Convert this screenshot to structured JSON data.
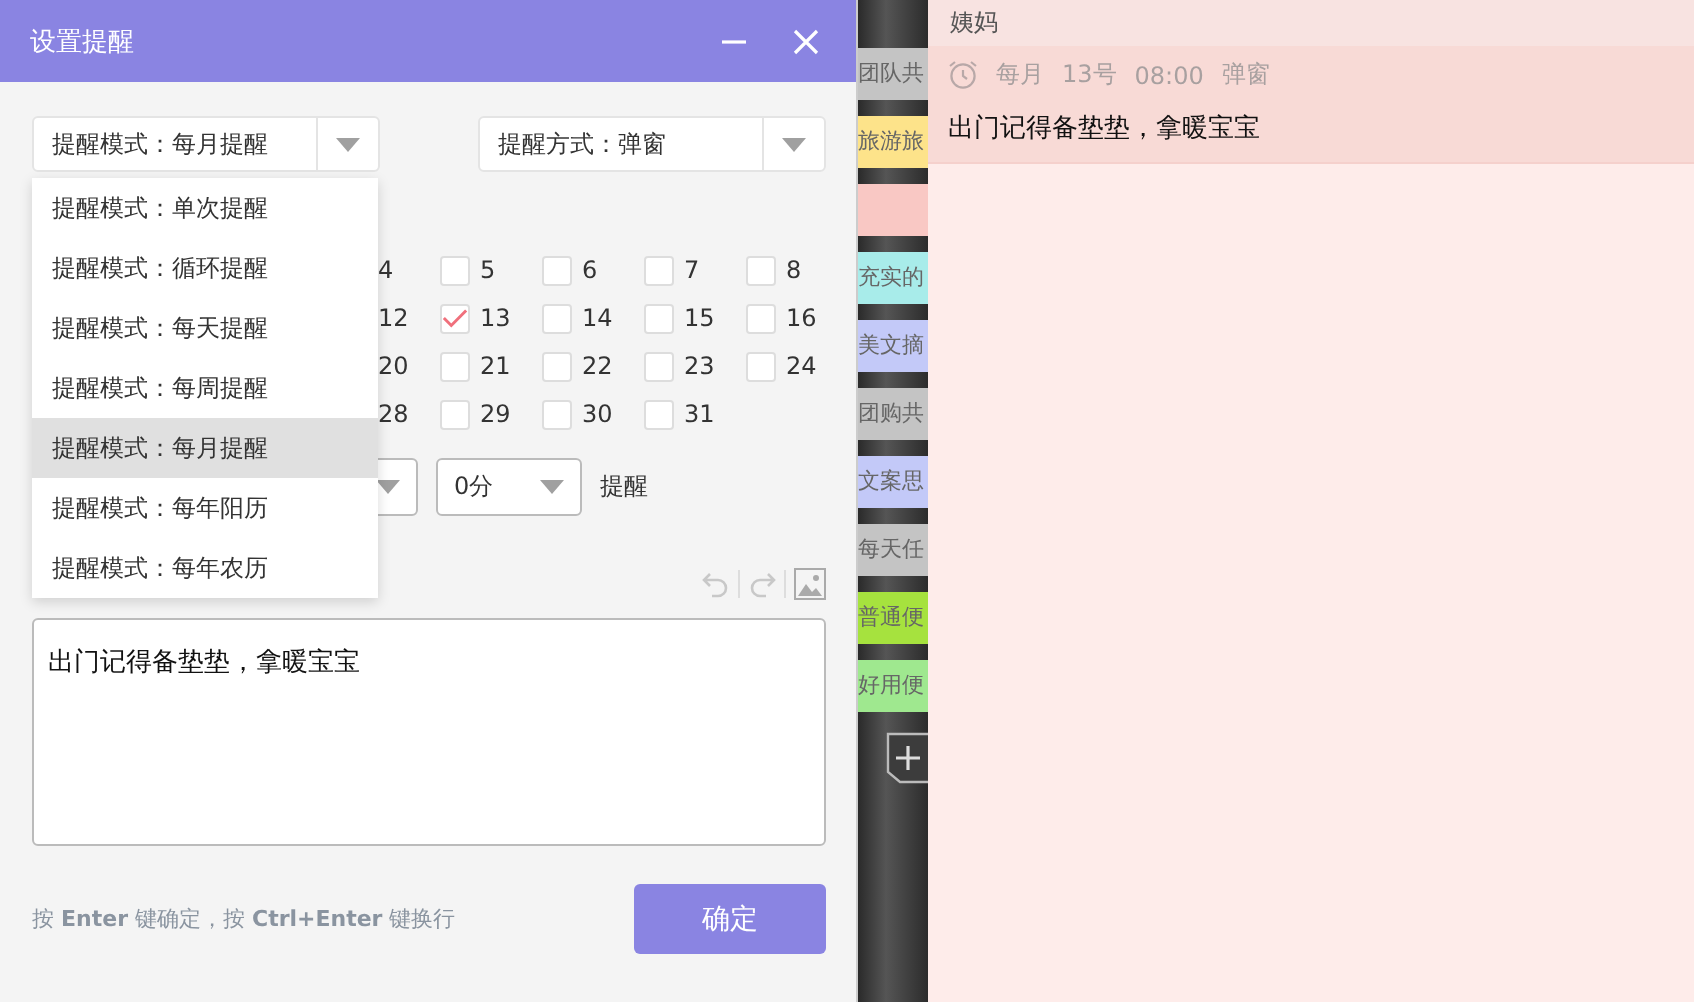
{
  "dialog": {
    "title": "设置提醒",
    "mode_select": {
      "value": "提醒模式：每月提醒"
    },
    "method_select": {
      "value": "提醒方式：弹窗"
    },
    "mode_options": [
      {
        "label": "提醒模式：单次提醒",
        "selected": false
      },
      {
        "label": "提醒模式：循环提醒",
        "selected": false
      },
      {
        "label": "提醒模式：每天提醒",
        "selected": false
      },
      {
        "label": "提醒模式：每周提醒",
        "selected": false
      },
      {
        "label": "提醒模式：每月提醒",
        "selected": true
      },
      {
        "label": "提醒模式：每年阳历",
        "selected": false
      },
      {
        "label": "提醒模式：每年农历",
        "selected": false
      }
    ],
    "days": [
      {
        "label": "4"
      },
      {
        "label": "5",
        "checked": false
      },
      {
        "label": "6",
        "checked": false
      },
      {
        "label": "7",
        "checked": false
      },
      {
        "label": "8",
        "checked": false
      },
      {
        "label": "12"
      },
      {
        "label": "13",
        "checked": true
      },
      {
        "label": "14",
        "checked": false
      },
      {
        "label": "15",
        "checked": false
      },
      {
        "label": "16",
        "checked": false
      },
      {
        "label": "20"
      },
      {
        "label": "21",
        "checked": false
      },
      {
        "label": "22",
        "checked": false
      },
      {
        "label": "23",
        "checked": false
      },
      {
        "label": "24",
        "checked": false
      },
      {
        "label": "28"
      },
      {
        "label": "29",
        "checked": false
      },
      {
        "label": "30",
        "checked": false
      },
      {
        "label": "31",
        "checked": false
      }
    ],
    "minute_select": {
      "value": "0分"
    },
    "time_suffix": "提醒",
    "content": "出门记得备垫垫，拿暖宝宝",
    "hint": "按 **Enter** 键确定，按 **Ctrl+Enter** 键换行",
    "confirm": "确定"
  },
  "tabs": [
    {
      "label": "团队共",
      "color": "#c4c4c4"
    },
    {
      "label": "旅游旅",
      "color": "#fde38a"
    },
    {
      "color": "#f9c8c4"
    },
    {
      "label": "充实的",
      "color": "#a8ecea"
    },
    {
      "label": "美文摘",
      "color": "#c3c9f8"
    },
    {
      "label": "团购共",
      "color": "#c4c4c4"
    },
    {
      "label": "文案思",
      "color": "#c3c9f8"
    },
    {
      "label": "每天任",
      "color": "#c4c4c4"
    },
    {
      "label": "普通便",
      "color": "#a6e23e"
    },
    {
      "label": "好用便",
      "color": "#9fe88f"
    }
  ],
  "note_panel": {
    "title": "姨妈",
    "note": {
      "schedule": [
        "每月",
        "13号",
        "08:00",
        "弹窗"
      ],
      "text": "出门记得备垫垫，拿暖宝宝"
    }
  }
}
